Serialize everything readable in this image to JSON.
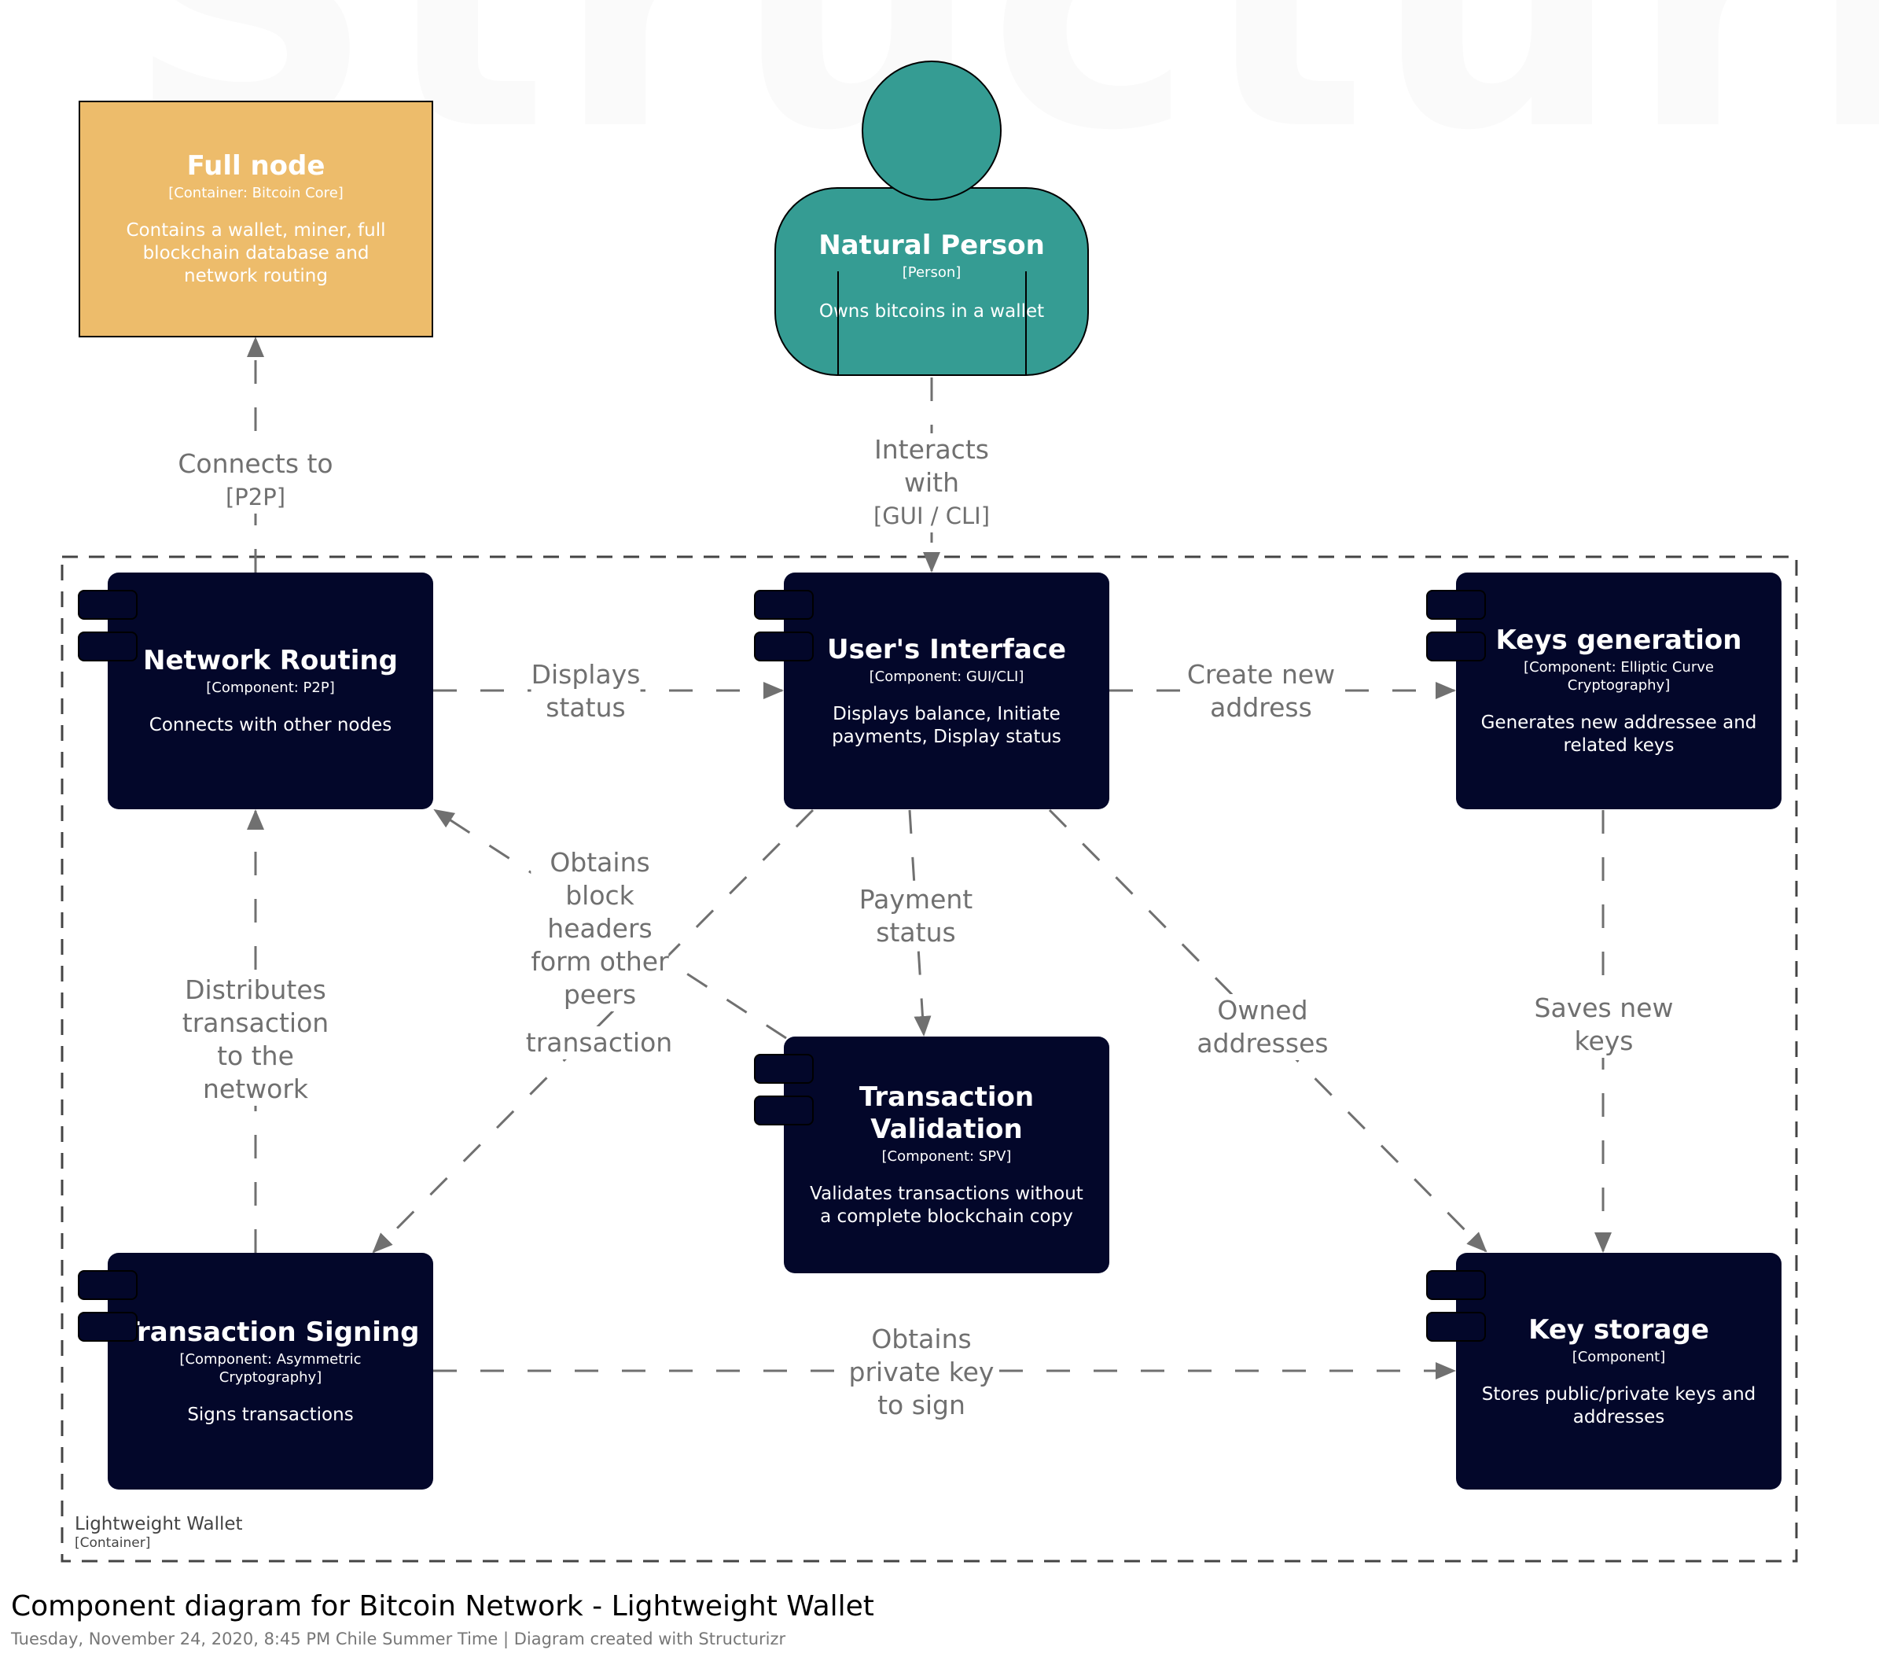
{
  "watermark": "Structurizr",
  "diagram": {
    "title": "Component diagram for Bitcoin Network - Lightweight Wallet",
    "meta": "Tuesday, November 24, 2020, 8:45 PM Chile Summer Time | Diagram created with Structurizr"
  },
  "colors": {
    "component": "#03072a",
    "container": "#edbc6b",
    "person": "#359c93",
    "relationship": "#707070",
    "boundary": "#444444"
  },
  "boundary": {
    "name": "Lightweight Wallet",
    "type": "[Container]"
  },
  "elements": {
    "full_node": {
      "name": "Full node",
      "type": "[Container: Bitcoin Core]",
      "description": "Contains a wallet, miner, full blockchain database and network routing"
    },
    "person": {
      "name": "Natural Person",
      "type": "[Person]",
      "description": "Owns bitcoins in a wallet"
    },
    "network_routing": {
      "name": "Network Routing",
      "type": "[Component: P2P]",
      "description": "Connects with other nodes"
    },
    "users_interface": {
      "name": "User's Interface",
      "type": "[Component: GUI/CLI]",
      "description": "Displays balance, Initiate payments, Display status"
    },
    "keys_generation": {
      "name": "Keys generation",
      "type": "[Component: Elliptic Curve Cryptography]",
      "description": "Generates new addressee and related keys"
    },
    "transaction_validation": {
      "name": "Transaction Validation",
      "type": "[Component: SPV]",
      "description": "Validates transactions without a complete blockchain copy"
    },
    "transaction_signing": {
      "name": "Transaction Signing",
      "type": "[Component: Asymmetric Cryptography]",
      "description": "Signs transactions"
    },
    "key_storage": {
      "name": "Key storage",
      "type": "[Component]",
      "description": "Stores public/private keys and addresses"
    }
  },
  "relationships": [
    {
      "id": "connects-to",
      "from": "network_routing",
      "to": "full_node",
      "label": "Connects to",
      "technology": "[P2P]"
    },
    {
      "id": "interacts-with",
      "from": "person",
      "to": "users_interface",
      "label": "Interacts with",
      "technology": "[GUI / CLI]"
    },
    {
      "id": "displays-status",
      "from": "network_routing",
      "to": "users_interface",
      "label": "Displays status",
      "technology": ""
    },
    {
      "id": "create-new-address",
      "from": "users_interface",
      "to": "keys_generation",
      "label": "Create new address",
      "technology": ""
    },
    {
      "id": "obtains-block-headers",
      "from": "transaction_validation",
      "to": "network_routing",
      "label": "Obtains block headers form other peers",
      "technology": ""
    },
    {
      "id": "transaction",
      "from": "users_interface",
      "to": "transaction_signing",
      "label": "transaction",
      "technology": ""
    },
    {
      "id": "payment-status",
      "from": "users_interface",
      "to": "transaction_validation",
      "label": "Payment status",
      "technology": ""
    },
    {
      "id": "owned-addresses",
      "from": "users_interface",
      "to": "key_storage",
      "label": "Owned addresses",
      "technology": ""
    },
    {
      "id": "saves-new-keys",
      "from": "keys_generation",
      "to": "key_storage",
      "label": "Saves new keys",
      "technology": ""
    },
    {
      "id": "distributes-transaction",
      "from": "transaction_signing",
      "to": "network_routing",
      "label": "Distributes transaction to the network",
      "technology": ""
    },
    {
      "id": "obtains-private-key",
      "from": "transaction_signing",
      "to": "key_storage",
      "label": "Obtains private key to sign",
      "technology": ""
    }
  ],
  "labels": {
    "connects_to": "Connects to",
    "connects_to_tech": "[P2P]",
    "interacts_with_1": "Interacts",
    "interacts_with_2": "with",
    "interacts_with_tech": "[GUI / CLI]",
    "displays_status_1": "Displays",
    "displays_status_2": "status",
    "create_new_address_1": "Create new",
    "create_new_address_2": "address",
    "obtains_block_1": "Obtains",
    "obtains_block_2": "block",
    "obtains_block_3": "headers",
    "obtains_block_4": "form other",
    "obtains_block_5": "peers",
    "transaction": "transaction",
    "payment_status_1": "Payment",
    "payment_status_2": "status",
    "owned_addresses_1": "Owned",
    "owned_addresses_2": "addresses",
    "saves_new_keys_1": "Saves new",
    "saves_new_keys_2": "keys",
    "distributes_1": "Distributes",
    "distributes_2": "transaction",
    "distributes_3": "to the",
    "distributes_4": "network",
    "private_key_1": "Obtains",
    "private_key_2": "private key",
    "private_key_3": "to sign"
  }
}
